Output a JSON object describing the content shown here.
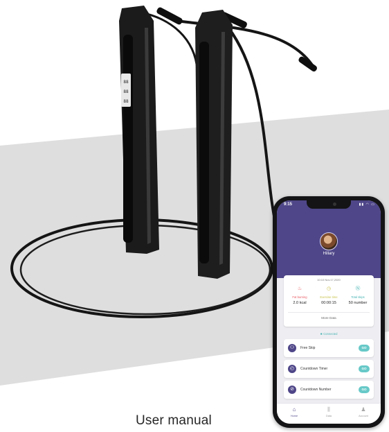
{
  "caption": "User manual",
  "app": {
    "status_time": "9:15",
    "status_icons": "▮▮ ◠ ▭",
    "user_name": "Hillary",
    "date": "10:10 Nov.17,2020",
    "stats": [
      {
        "label": "Fat burning",
        "value": "2.0 kcal",
        "icon": "flame-icon",
        "color": "#e85a62",
        "glyph": "♨"
      },
      {
        "label": "Exercise time",
        "value": "00:00:15",
        "icon": "clock-icon",
        "color": "#c8c24a",
        "glyph": "◷"
      },
      {
        "label": "Total skips",
        "value": "50 number",
        "icon": "skip-count-icon",
        "color": "#47b3b3",
        "glyph": "Ⓝ"
      }
    ],
    "more_data": "More Data",
    "connection_status": "✱ Connected",
    "modes": [
      {
        "label": "Free Skip",
        "button": "GO",
        "icon": "jump-rope-icon",
        "glyph": "⚇"
      },
      {
        "label": "Countdown Timer",
        "button": "GO",
        "icon": "timer-icon",
        "glyph": "◴"
      },
      {
        "label": "Countdown Number",
        "button": "GO",
        "icon": "counter-icon",
        "glyph": "⊘"
      }
    ],
    "tabs": [
      {
        "label": "Home",
        "icon": "home-icon",
        "glyph": "⌂",
        "active": true
      },
      {
        "label": "Data",
        "icon": "bar-chart-icon",
        "glyph": "⫼",
        "active": false
      },
      {
        "label": "Account",
        "icon": "person-icon",
        "glyph": "♟",
        "active": false
      }
    ],
    "colors": {
      "header": "#4e4688",
      "accent": "#67c9c8",
      "fat": "#e85a62",
      "time": "#c8c24a",
      "skips": "#47b3b3"
    }
  }
}
